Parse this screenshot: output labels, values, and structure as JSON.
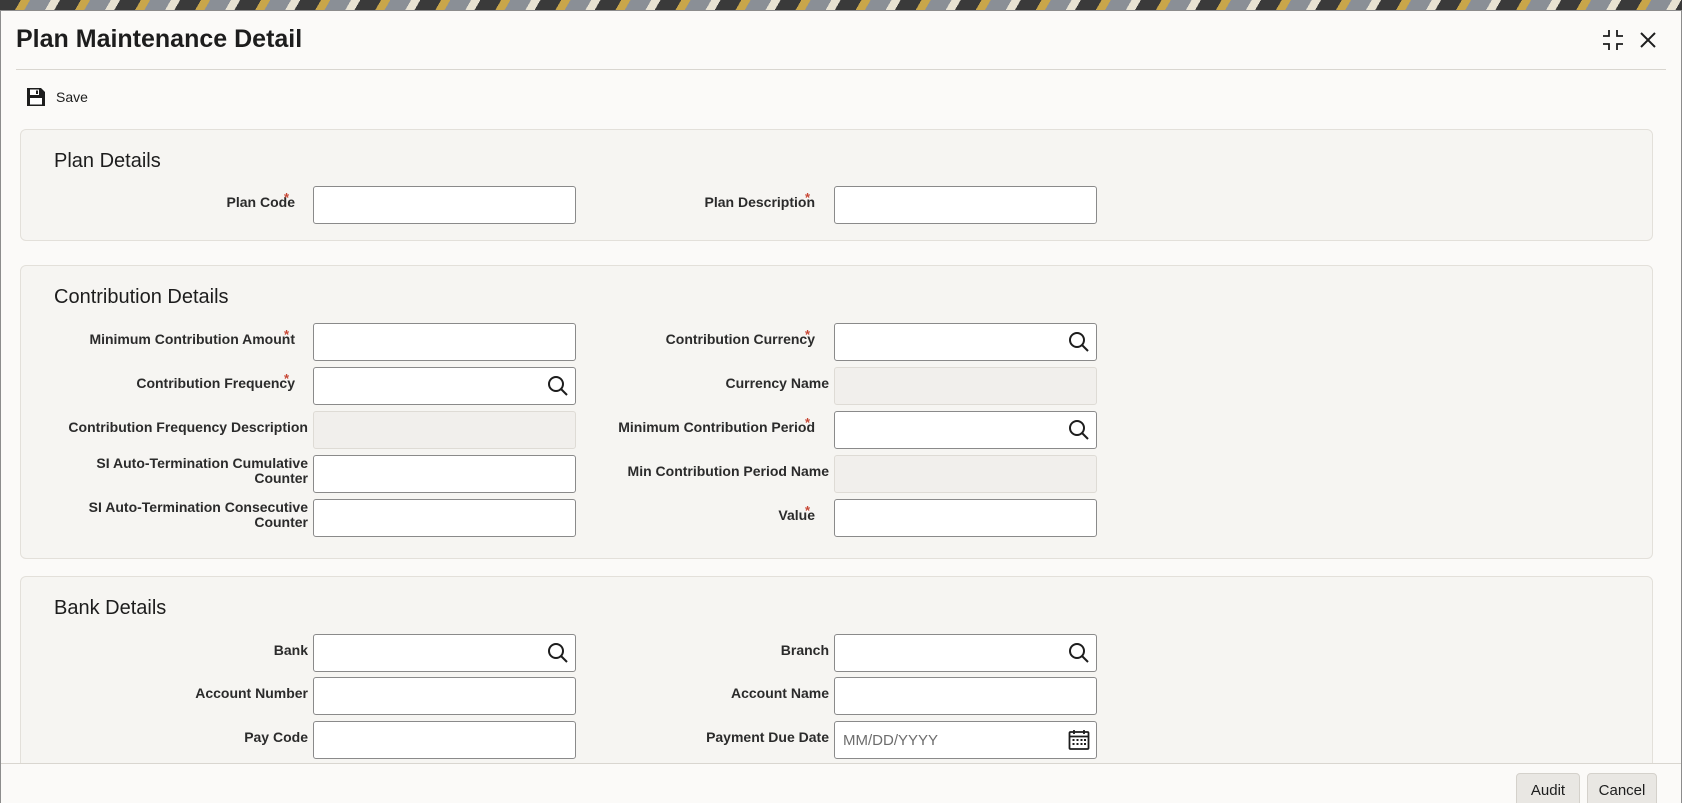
{
  "window": {
    "title": "Plan Maintenance Detail"
  },
  "toolbar": {
    "save_label": "Save"
  },
  "plan_details": {
    "heading": "Plan Details",
    "plan_code_label": "Plan Code",
    "plan_code_value": "",
    "plan_description_label": "Plan Description",
    "plan_description_value": "",
    "required_mark": "*"
  },
  "contribution_details": {
    "heading": "Contribution Details",
    "min_amount_label": "Minimum Contribution Amount",
    "frequency_label": "Contribution Frequency",
    "frequency_desc_label": "Contribution Frequency Description",
    "si_cumulative_label_line1": "SI Auto-Termination Cumulative",
    "si_cumulative_label_line2": "Counter",
    "si_consecutive_label_line1": "SI Auto-Termination Consecutive",
    "si_consecutive_label_line2": "Counter",
    "currency_label": "Contribution Currency",
    "currency_name_label": "Currency Name",
    "min_period_label": "Minimum Contribution Period",
    "min_period_name_label": "Min Contribution Period Name",
    "value_label": "Value",
    "required_mark": "*"
  },
  "bank_details": {
    "heading": "Bank Details",
    "bank_label": "Bank",
    "account_number_label": "Account Number",
    "pay_code_label": "Pay Code",
    "branch_label": "Branch",
    "account_name_label": "Account Name",
    "payment_due_date_label": "Payment Due Date",
    "payment_due_date_placeholder": "MM/DD/YYYY"
  },
  "footer": {
    "audit_label": "Audit",
    "cancel_label": "Cancel"
  },
  "icons": {
    "save": "save-icon",
    "maximize": "maximize-icon",
    "close": "close-icon",
    "lookup": "search-icon",
    "calendar": "calendar-icon"
  },
  "colors": {
    "required": "#c74634",
    "panel": "#f6f5f2",
    "button": "#e9e7e3"
  }
}
